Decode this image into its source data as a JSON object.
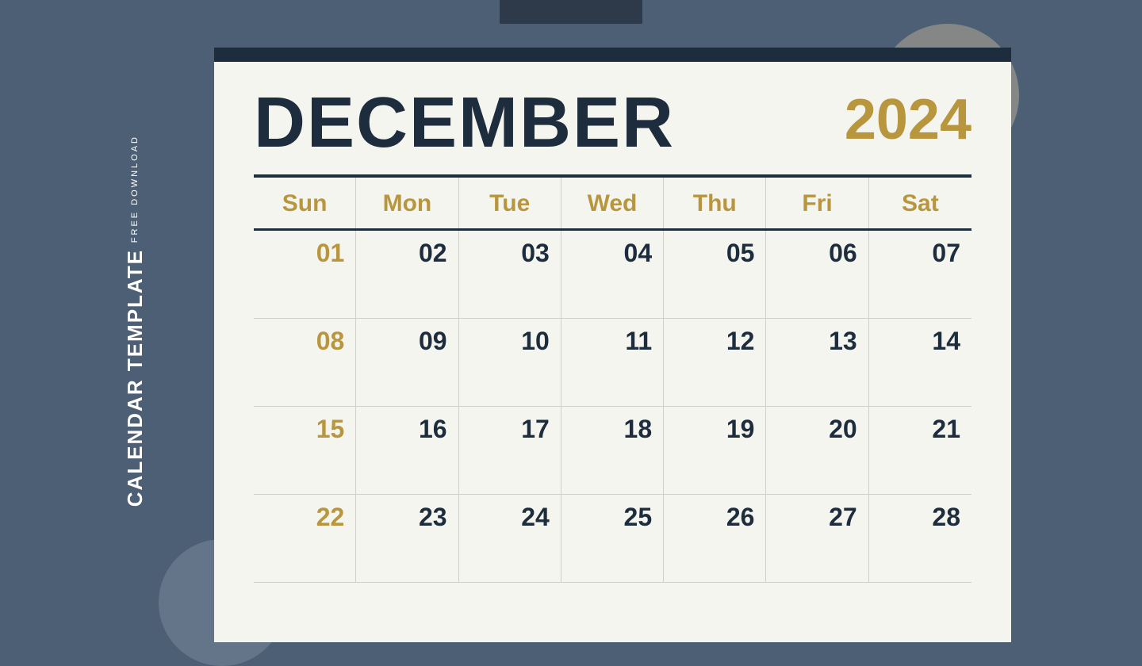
{
  "background": {
    "color": "#4d5f75"
  },
  "sidebar": {
    "free_download_label": "FREE DOWNLOAD",
    "title_label": "CALENDAR TEMPLATE"
  },
  "calendar": {
    "month": "DECEMBER",
    "year": "2024",
    "days_of_week": [
      "Sun",
      "Mon",
      "Tue",
      "Wed",
      "Thu",
      "Fri",
      "Sat"
    ],
    "rows": [
      {
        "cells": [
          {
            "day": "01",
            "highlight": true
          },
          {
            "day": "02",
            "highlight": false
          },
          {
            "day": "03",
            "highlight": false
          },
          {
            "day": "04",
            "highlight": false
          },
          {
            "day": "05",
            "highlight": false
          },
          {
            "day": "06",
            "highlight": false
          },
          {
            "day": "07",
            "highlight": false
          }
        ]
      },
      {
        "cells": [
          {
            "day": "08",
            "highlight": true
          },
          {
            "day": "09",
            "highlight": false
          },
          {
            "day": "10",
            "highlight": false
          },
          {
            "day": "11",
            "highlight": false
          },
          {
            "day": "12",
            "highlight": false
          },
          {
            "day": "13",
            "highlight": false
          },
          {
            "day": "14",
            "highlight": false
          }
        ]
      },
      {
        "cells": [
          {
            "day": "15",
            "highlight": true
          },
          {
            "day": "16",
            "highlight": false
          },
          {
            "day": "17",
            "highlight": false
          },
          {
            "day": "18",
            "highlight": false
          },
          {
            "day": "19",
            "highlight": false
          },
          {
            "day": "20",
            "highlight": false
          },
          {
            "day": "21",
            "highlight": false
          }
        ]
      },
      {
        "cells": [
          {
            "day": "22",
            "highlight": true
          },
          {
            "day": "23",
            "highlight": false
          },
          {
            "day": "24",
            "highlight": false
          },
          {
            "day": "25",
            "highlight": false
          },
          {
            "day": "26",
            "highlight": false
          },
          {
            "day": "27",
            "highlight": false
          },
          {
            "day": "28",
            "highlight": false
          }
        ]
      }
    ]
  }
}
